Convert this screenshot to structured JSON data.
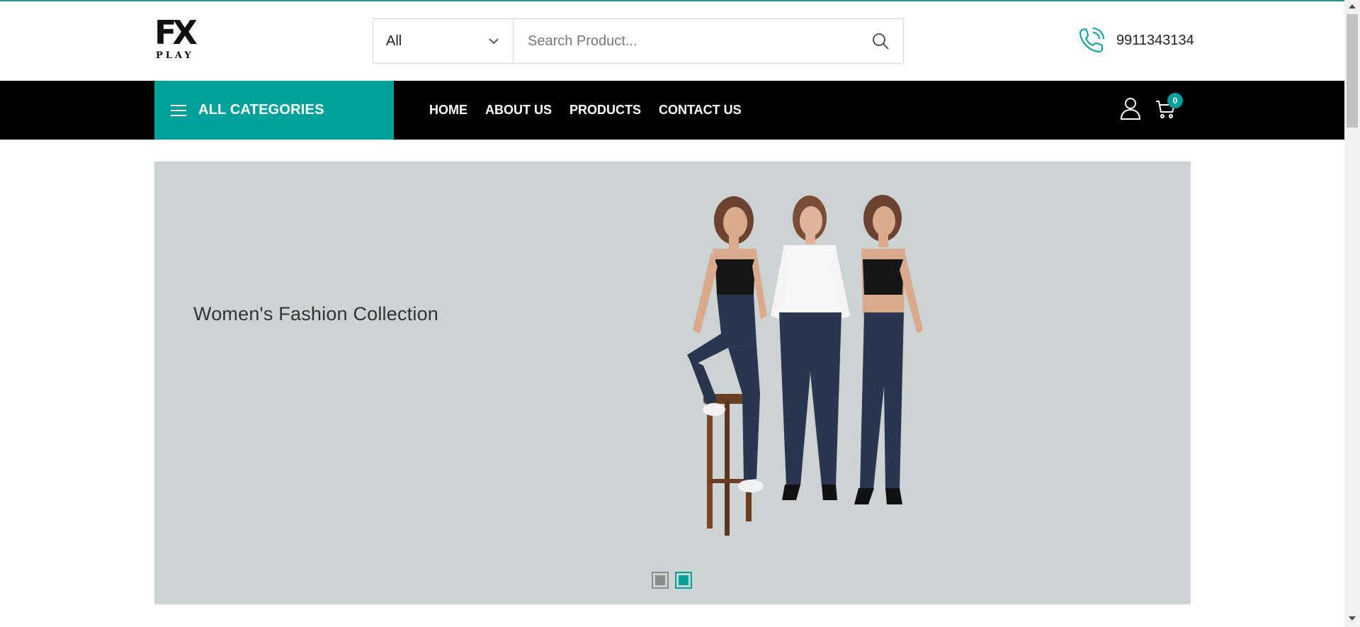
{
  "brand": {
    "logo_top": "FX",
    "logo_bottom": "PLAY"
  },
  "search": {
    "category_selected": "All",
    "placeholder": "Search Product..."
  },
  "contact": {
    "phone": "9911343134"
  },
  "nav": {
    "all_categories_label": "ALL CATEGORIES",
    "items": [
      {
        "label": "HOME"
      },
      {
        "label": "ABOUT US"
      },
      {
        "label": "PRODUCTS"
      },
      {
        "label": "CONTACT US"
      }
    ],
    "cart_count": "0"
  },
  "hero": {
    "title": "Women's Fashion Collection",
    "slides_total": 2,
    "active_slide": 2
  },
  "colors": {
    "accent": "#00a19a",
    "navbar": "#000000",
    "hero_bg": "#cdd2d2",
    "pants": "#2a3550",
    "top_black": "#161616",
    "shirt_white": "#f7f7f7",
    "skin": "#d9a98c",
    "hair": "#6b4330"
  },
  "icons": [
    "search-icon",
    "chevron-down-icon",
    "phone-icon",
    "menu-icon",
    "user-icon",
    "cart-icon"
  ]
}
